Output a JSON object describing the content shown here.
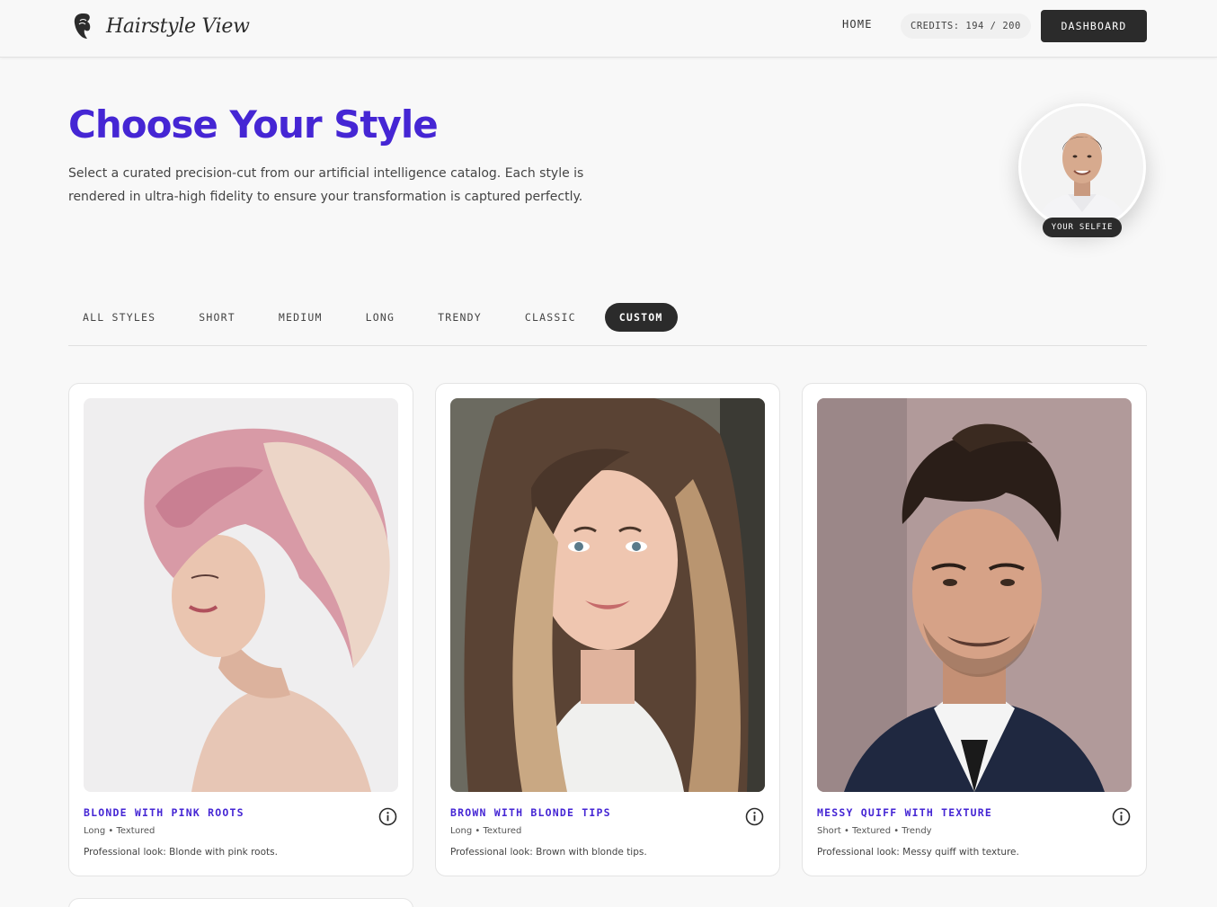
{
  "header": {
    "brand": "Hairstyle View",
    "nav_home": "HOME",
    "credits": "CREDITS: 194 / 200",
    "dashboard": "DASHBOARD"
  },
  "hero": {
    "title": "Choose Your Style",
    "subtitle": "Select a curated precision-cut from our artificial intelligence catalog. Each style is rendered in ultra-high fidelity to ensure your transformation is captured perfectly.",
    "selfie_label": "YOUR SELFIE"
  },
  "tabs": [
    {
      "label": "ALL STYLES",
      "active": false
    },
    {
      "label": "SHORT",
      "active": false
    },
    {
      "label": "MEDIUM",
      "active": false
    },
    {
      "label": "LONG",
      "active": false
    },
    {
      "label": "TRENDY",
      "active": false
    },
    {
      "label": "CLASSIC",
      "active": false
    },
    {
      "label": "CUSTOM",
      "active": true
    }
  ],
  "cards": [
    {
      "name": "BLONDE WITH PINK ROOTS",
      "tags": "Long • Textured",
      "desc": "Professional look: Blonde with pink roots."
    },
    {
      "name": "BROWN WITH BLONDE TIPS",
      "tags": "Long • Textured",
      "desc": "Professional look: Brown with blonde tips."
    },
    {
      "name": "MESSY QUIFF WITH TEXTURE",
      "tags": "Short • Textured • Trendy",
      "desc": "Professional look: Messy quiff with texture."
    }
  ],
  "colors": {
    "accent": "#4526d4",
    "dark": "#2b2b2b",
    "background": "#f8f8f8"
  },
  "icons": {
    "logo": "hair-silhouette-icon",
    "info": "info-icon"
  }
}
